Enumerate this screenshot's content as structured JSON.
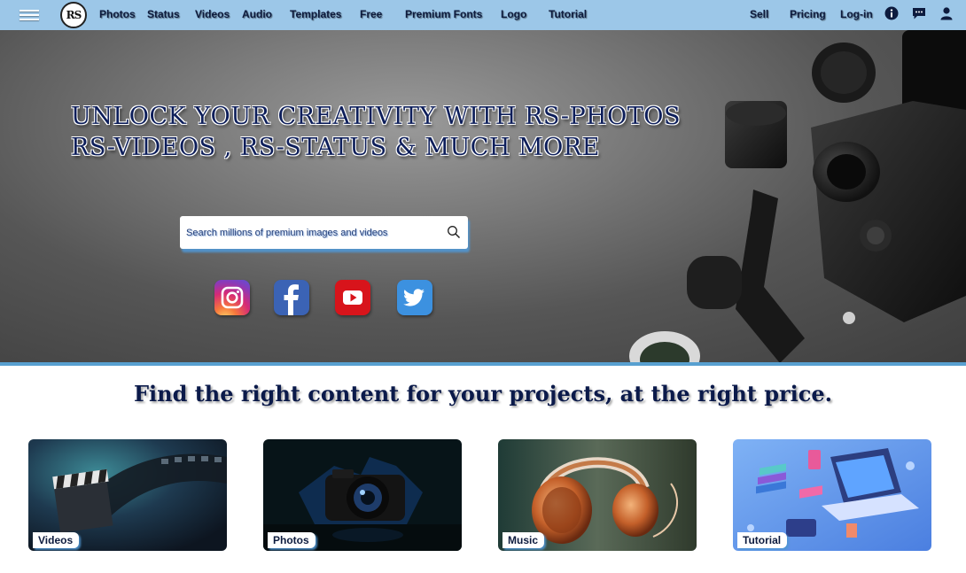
{
  "nav": {
    "logo_text": "RS",
    "links": [
      "Photos",
      "Status",
      "Videos",
      "Audio",
      "Templates",
      "Free",
      "Premium Fonts",
      "Logo",
      "Tutorial"
    ],
    "right_links": [
      "Sell",
      "Pricing",
      "Log-in"
    ],
    "icons": [
      "info-icon",
      "chat-icon",
      "user-icon"
    ]
  },
  "hero": {
    "headline_line1": "UNLOCK YOUR CREATIVITY WITH RS-PHOTOS",
    "headline_line2": "RS-VIDEOS , RS-STATUS & MUCH MORE",
    "search_placeholder": "Search millions of premium images and videos",
    "social": [
      "instagram",
      "facebook",
      "youtube",
      "twitter"
    ]
  },
  "section": {
    "tagline": "Find the right content for your projects, at the right price."
  },
  "categories": [
    {
      "label": "Videos"
    },
    {
      "label": "Photos"
    },
    {
      "label": "Music"
    },
    {
      "label": "Tutorial"
    }
  ],
  "colors": {
    "nav_bg": "#9cc7e8",
    "accent": "#58a0d0",
    "heading": "#0b1a4a"
  }
}
